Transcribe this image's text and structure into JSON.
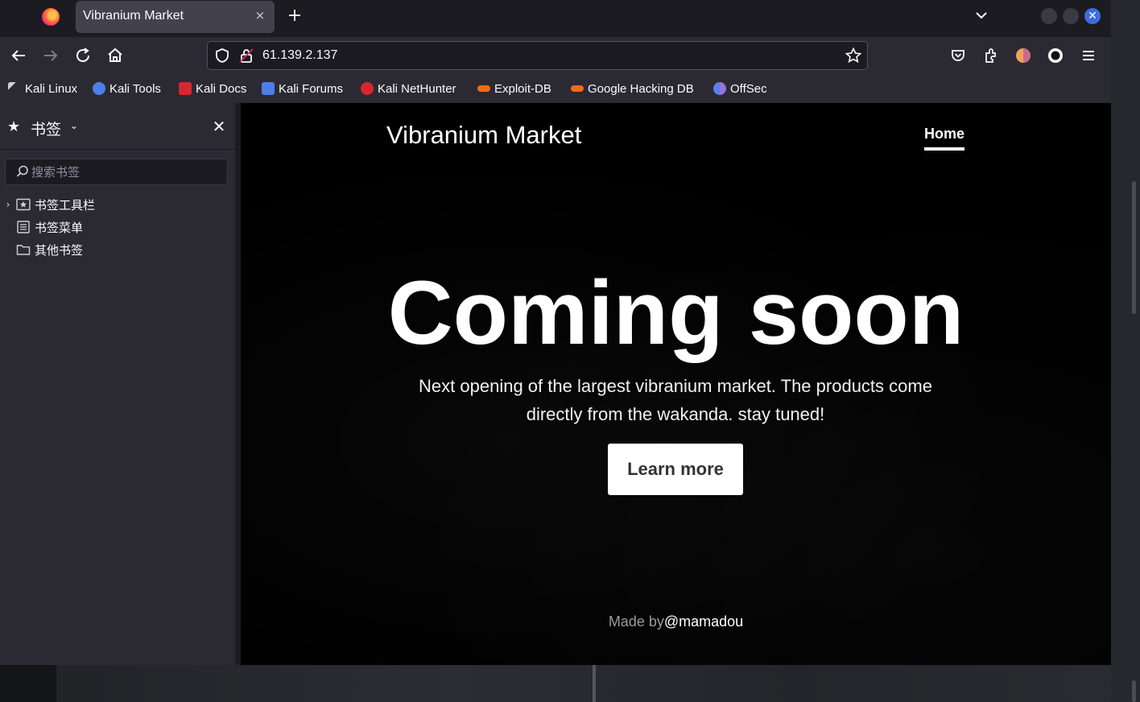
{
  "browser": {
    "tab_title": "Vibranium Market",
    "tab_close": "×",
    "new_tab": "+",
    "url": "61.139.2.137"
  },
  "bookmarks_toolbar": [
    {
      "label": "Kali Linux",
      "icon": "kali-dragon-icon",
      "color": "#cfcfd8"
    },
    {
      "label": "Kali Tools",
      "icon": "kali-tools-icon",
      "color": "#4d7ee8"
    },
    {
      "label": "Kali Docs",
      "icon": "kali-docs-icon",
      "color": "#d9262e"
    },
    {
      "label": "Kali Forums",
      "icon": "kali-forums-icon",
      "color": "#4d7ee8"
    },
    {
      "label": "Kali NetHunter",
      "icon": "kali-nethunter-icon",
      "color": "#d9262e"
    },
    {
      "label": "Exploit-DB",
      "icon": "exploit-db-icon",
      "color": "#f06a1d"
    },
    {
      "label": "Google Hacking DB",
      "icon": "ghdb-icon",
      "color": "#f06a1d"
    },
    {
      "label": "OffSec",
      "icon": "offsec-icon",
      "color": "#5b7fe8"
    }
  ],
  "sidebar": {
    "title": "书签",
    "search_placeholder": "搜索书签",
    "items": [
      {
        "label": "书签工具栏",
        "icon": "bookmarks-toolbar-icon",
        "expandable": true
      },
      {
        "label": "书签菜单",
        "icon": "bookmarks-menu-icon",
        "expandable": false
      },
      {
        "label": "其他书签",
        "icon": "folder-icon",
        "expandable": false
      }
    ]
  },
  "site": {
    "brand": "Vibranium Market",
    "nav_home": "Home",
    "hero_title": "Coming soon",
    "hero_lead": "Next opening of the largest vibranium market. The products come directly from the wakanda. stay tuned!",
    "hero_button": "Learn more",
    "footer_prefix": "Made by",
    "footer_author": "@mamadou"
  },
  "colors": {
    "accent_close": "#3b6ddb",
    "content_bg": "#000000",
    "chrome_bg": "#2b2a33"
  }
}
